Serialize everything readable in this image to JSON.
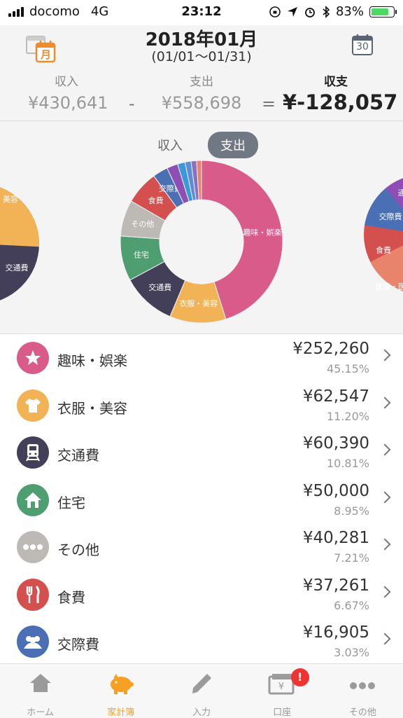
{
  "status": {
    "carrier": "docomo",
    "network": "4G",
    "time": "23:12",
    "battery": "83%",
    "battery_level": 0.83
  },
  "header": {
    "month": "2018年01月",
    "range": "(01/01〜01/31)",
    "calendar_badge_left": "月",
    "calendar_badge_right": "30",
    "income_label": "収入",
    "income_value": "¥430,641",
    "minus": "-",
    "expense_label": "支出",
    "expense_value": "¥558,698",
    "equals": "=",
    "balance_label": "収支",
    "balance_value": "¥-128,057"
  },
  "toggle": {
    "income": "収入",
    "expense": "支出",
    "selected": "expense"
  },
  "side_left_labels": [
    "美容",
    "交通費"
  ],
  "side_right_labels": [
    "通",
    "交際費",
    "食費",
    "健康・医"
  ],
  "chart_data": {
    "type": "pie",
    "title": "",
    "labels": [
      "趣味・娯楽",
      "衣服・美容",
      "交通費",
      "住宅",
      "その他",
      "食費",
      "交際費",
      "",
      "",
      "",
      "",
      ""
    ],
    "values": [
      45.15,
      11.2,
      10.81,
      8.95,
      7.21,
      6.67,
      3.03,
      2.2,
      1.5,
      1.2,
      1.1,
      0.97
    ],
    "colors": [
      "#d95b8a",
      "#f2b356",
      "#433f58",
      "#4f9e72",
      "#bdb9b4",
      "#d4504e",
      "#4a6fb5",
      "#8e4eb5",
      "#3a9ad9",
      "#5b8ed6",
      "#8a6fc2",
      "#e8846b"
    ]
  },
  "categories": [
    {
      "name": "趣味・娯楽",
      "amount": "¥252,260",
      "pct": "45.15%",
      "color": "#d95b8a",
      "icon": "star-icon"
    },
    {
      "name": "衣服・美容",
      "amount": "¥62,547",
      "pct": "11.20%",
      "color": "#f2b356",
      "icon": "tshirt-icon"
    },
    {
      "name": "交通費",
      "amount": "¥60,390",
      "pct": "10.81%",
      "color": "#433f58",
      "icon": "train-icon"
    },
    {
      "name": "住宅",
      "amount": "¥50,000",
      "pct": "8.95%",
      "color": "#4f9e72",
      "icon": "house-icon"
    },
    {
      "name": "その他",
      "amount": "¥40,281",
      "pct": "7.21%",
      "color": "#bdb9b4",
      "icon": "dots-icon"
    },
    {
      "name": "食費",
      "amount": "¥37,261",
      "pct": "6.67%",
      "color": "#d4504e",
      "icon": "fork-knife-icon"
    },
    {
      "name": "交際費",
      "amount": "¥16,905",
      "pct": "3.03%",
      "color": "#4a6fb5",
      "icon": "people-icon"
    }
  ],
  "tabs": [
    {
      "label": "ホーム",
      "icon": "home-icon"
    },
    {
      "label": "家計簿",
      "icon": "piggy-bank-icon",
      "active": true
    },
    {
      "label": "入力",
      "icon": "pencil-icon"
    },
    {
      "label": "口座",
      "icon": "wallet-icon",
      "badge": "!"
    },
    {
      "label": "その他",
      "icon": "more-icon"
    }
  ]
}
